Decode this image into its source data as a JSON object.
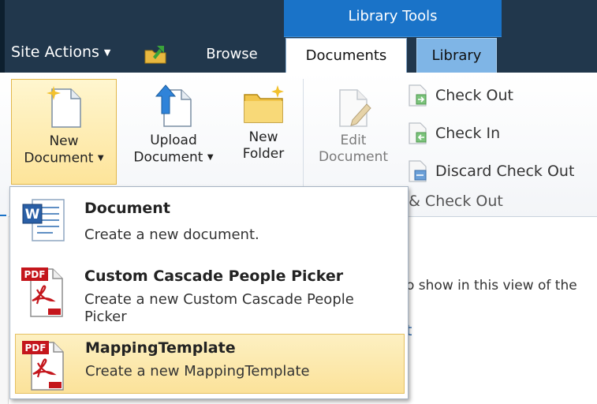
{
  "topbar": {
    "site_actions": "Site Actions",
    "context_title": "Library Tools",
    "tabs": {
      "browse": "Browse",
      "documents": "Documents",
      "library": "Library"
    }
  },
  "ribbon": {
    "new_document": {
      "line1": "New",
      "line2": "Document"
    },
    "upload_document": {
      "line1": "Upload",
      "line2": "Document"
    },
    "new_folder": {
      "line1": "New",
      "line2": "Folder"
    },
    "edit_document": {
      "line1": "Edit",
      "line2": "Document"
    },
    "check_out": "Check Out",
    "check_in": "Check In",
    "discard_check_out": "Discard Check Out",
    "group_label": "n & Check Out"
  },
  "dropdown": {
    "items": [
      {
        "title": "Document",
        "description": "Create a new document."
      },
      {
        "title": "Custom Cascade People Picker",
        "description": "Create a new Custom Cascade People Picker"
      },
      {
        "title": "MappingTemplate",
        "description": "Create a new MappingTemplate"
      }
    ]
  },
  "background": {
    "view_text": "o show in this view of the",
    "link_fragment": "t"
  },
  "colors": {
    "topbar": "#21374c",
    "context_blue": "#1a73c8",
    "library_tab": "#7fb5e6",
    "highlight": "#fbe29a"
  },
  "icons": [
    "navigate-up-icon",
    "new-document-icon",
    "upload-document-icon",
    "new-folder-icon",
    "edit-document-icon",
    "check-out-icon",
    "check-in-icon",
    "discard-check-out-icon",
    "word-document-icon",
    "pdf-icon"
  ]
}
